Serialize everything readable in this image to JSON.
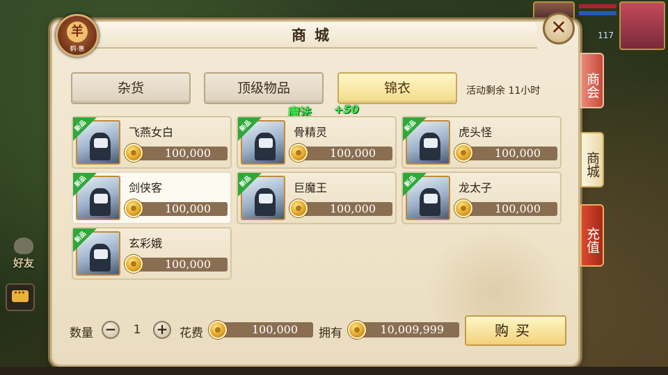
{
  "title": "商城",
  "vip_badge": {
    "glyph": "羊",
    "label": "鹤·惠"
  },
  "close_label": "✕",
  "tabs": [
    {
      "label": "杂货",
      "active": false
    },
    {
      "label": "顶级物品",
      "active": false
    },
    {
      "label": "锦衣",
      "active": true
    }
  ],
  "event_timer": "活动剩余 11小时",
  "floating_gain": {
    "label": "魔法",
    "amount": "+50"
  },
  "new_badge": "新品",
  "items": [
    {
      "name": "飞燕女白",
      "price": "100,000",
      "selected": false
    },
    {
      "name": "骨精灵",
      "price": "100,000",
      "selected": false
    },
    {
      "name": "虎头怪",
      "price": "100,000",
      "selected": false
    },
    {
      "name": "剑侠客",
      "price": "100,000",
      "selected": true
    },
    {
      "name": "巨魔王",
      "price": "100,000",
      "selected": false
    },
    {
      "name": "龙太子",
      "price": "100,000",
      "selected": false
    },
    {
      "name": "玄彩娥",
      "price": "100,000",
      "selected": false
    }
  ],
  "bottom": {
    "qty_label": "数量",
    "minus": "−",
    "qty": "1",
    "plus": "+",
    "cost_label": "花费",
    "cost": "100,000",
    "own_label": "拥有",
    "own": "10,009,999",
    "buy_label": "购买"
  },
  "side_tabs": {
    "shanghui": "商会",
    "shangcheng": "商城",
    "chongzhi": "充值"
  },
  "left_hud": {
    "friends": "好友"
  },
  "top_hud": {
    "number": "117"
  },
  "colors": {
    "price_bar": "#8a6e52",
    "active_tab": "#f2dc8a",
    "new_ribbon": "#2fa83a",
    "gain_text": "#3fe84a"
  }
}
